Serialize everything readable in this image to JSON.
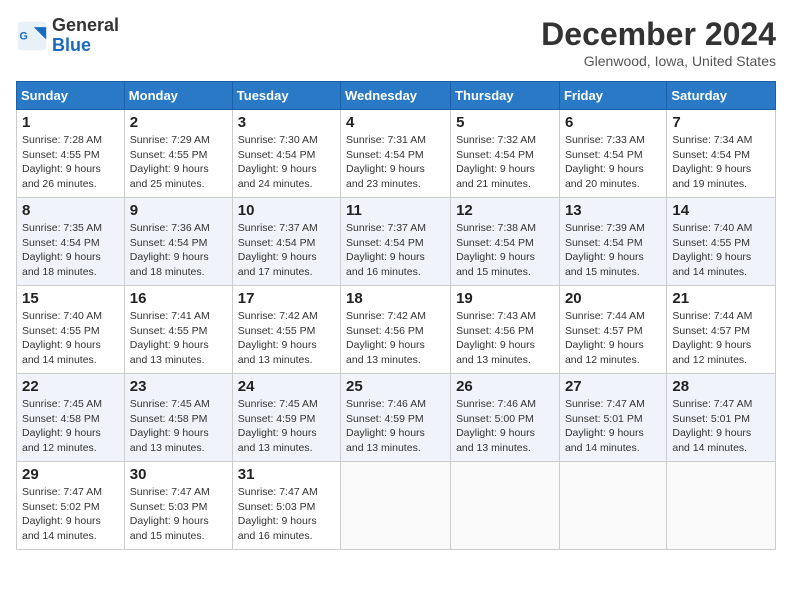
{
  "header": {
    "logo": {
      "general": "General",
      "blue": "Blue"
    },
    "title": "December 2024",
    "location": "Glenwood, Iowa, United States"
  },
  "weekdays": [
    "Sunday",
    "Monday",
    "Tuesday",
    "Wednesday",
    "Thursday",
    "Friday",
    "Saturday"
  ],
  "weeks": [
    [
      {
        "day": 1,
        "sunrise": "Sunrise: 7:28 AM",
        "sunset": "Sunset: 4:55 PM",
        "daylight": "Daylight: 9 hours and 26 minutes."
      },
      {
        "day": 2,
        "sunrise": "Sunrise: 7:29 AM",
        "sunset": "Sunset: 4:55 PM",
        "daylight": "Daylight: 9 hours and 25 minutes."
      },
      {
        "day": 3,
        "sunrise": "Sunrise: 7:30 AM",
        "sunset": "Sunset: 4:54 PM",
        "daylight": "Daylight: 9 hours and 24 minutes."
      },
      {
        "day": 4,
        "sunrise": "Sunrise: 7:31 AM",
        "sunset": "Sunset: 4:54 PM",
        "daylight": "Daylight: 9 hours and 23 minutes."
      },
      {
        "day": 5,
        "sunrise": "Sunrise: 7:32 AM",
        "sunset": "Sunset: 4:54 PM",
        "daylight": "Daylight: 9 hours and 21 minutes."
      },
      {
        "day": 6,
        "sunrise": "Sunrise: 7:33 AM",
        "sunset": "Sunset: 4:54 PM",
        "daylight": "Daylight: 9 hours and 20 minutes."
      },
      {
        "day": 7,
        "sunrise": "Sunrise: 7:34 AM",
        "sunset": "Sunset: 4:54 PM",
        "daylight": "Daylight: 9 hours and 19 minutes."
      }
    ],
    [
      {
        "day": 8,
        "sunrise": "Sunrise: 7:35 AM",
        "sunset": "Sunset: 4:54 PM",
        "daylight": "Daylight: 9 hours and 18 minutes."
      },
      {
        "day": 9,
        "sunrise": "Sunrise: 7:36 AM",
        "sunset": "Sunset: 4:54 PM",
        "daylight": "Daylight: 9 hours and 18 minutes."
      },
      {
        "day": 10,
        "sunrise": "Sunrise: 7:37 AM",
        "sunset": "Sunset: 4:54 PM",
        "daylight": "Daylight: 9 hours and 17 minutes."
      },
      {
        "day": 11,
        "sunrise": "Sunrise: 7:37 AM",
        "sunset": "Sunset: 4:54 PM",
        "daylight": "Daylight: 9 hours and 16 minutes."
      },
      {
        "day": 12,
        "sunrise": "Sunrise: 7:38 AM",
        "sunset": "Sunset: 4:54 PM",
        "daylight": "Daylight: 9 hours and 15 minutes."
      },
      {
        "day": 13,
        "sunrise": "Sunrise: 7:39 AM",
        "sunset": "Sunset: 4:54 PM",
        "daylight": "Daylight: 9 hours and 15 minutes."
      },
      {
        "day": 14,
        "sunrise": "Sunrise: 7:40 AM",
        "sunset": "Sunset: 4:55 PM",
        "daylight": "Daylight: 9 hours and 14 minutes."
      }
    ],
    [
      {
        "day": 15,
        "sunrise": "Sunrise: 7:40 AM",
        "sunset": "Sunset: 4:55 PM",
        "daylight": "Daylight: 9 hours and 14 minutes."
      },
      {
        "day": 16,
        "sunrise": "Sunrise: 7:41 AM",
        "sunset": "Sunset: 4:55 PM",
        "daylight": "Daylight: 9 hours and 13 minutes."
      },
      {
        "day": 17,
        "sunrise": "Sunrise: 7:42 AM",
        "sunset": "Sunset: 4:55 PM",
        "daylight": "Daylight: 9 hours and 13 minutes."
      },
      {
        "day": 18,
        "sunrise": "Sunrise: 7:42 AM",
        "sunset": "Sunset: 4:56 PM",
        "daylight": "Daylight: 9 hours and 13 minutes."
      },
      {
        "day": 19,
        "sunrise": "Sunrise: 7:43 AM",
        "sunset": "Sunset: 4:56 PM",
        "daylight": "Daylight: 9 hours and 13 minutes."
      },
      {
        "day": 20,
        "sunrise": "Sunrise: 7:44 AM",
        "sunset": "Sunset: 4:57 PM",
        "daylight": "Daylight: 9 hours and 12 minutes."
      },
      {
        "day": 21,
        "sunrise": "Sunrise: 7:44 AM",
        "sunset": "Sunset: 4:57 PM",
        "daylight": "Daylight: 9 hours and 12 minutes."
      }
    ],
    [
      {
        "day": 22,
        "sunrise": "Sunrise: 7:45 AM",
        "sunset": "Sunset: 4:58 PM",
        "daylight": "Daylight: 9 hours and 12 minutes."
      },
      {
        "day": 23,
        "sunrise": "Sunrise: 7:45 AM",
        "sunset": "Sunset: 4:58 PM",
        "daylight": "Daylight: 9 hours and 13 minutes."
      },
      {
        "day": 24,
        "sunrise": "Sunrise: 7:45 AM",
        "sunset": "Sunset: 4:59 PM",
        "daylight": "Daylight: 9 hours and 13 minutes."
      },
      {
        "day": 25,
        "sunrise": "Sunrise: 7:46 AM",
        "sunset": "Sunset: 4:59 PM",
        "daylight": "Daylight: 9 hours and 13 minutes."
      },
      {
        "day": 26,
        "sunrise": "Sunrise: 7:46 AM",
        "sunset": "Sunset: 5:00 PM",
        "daylight": "Daylight: 9 hours and 13 minutes."
      },
      {
        "day": 27,
        "sunrise": "Sunrise: 7:47 AM",
        "sunset": "Sunset: 5:01 PM",
        "daylight": "Daylight: 9 hours and 14 minutes."
      },
      {
        "day": 28,
        "sunrise": "Sunrise: 7:47 AM",
        "sunset": "Sunset: 5:01 PM",
        "daylight": "Daylight: 9 hours and 14 minutes."
      }
    ],
    [
      {
        "day": 29,
        "sunrise": "Sunrise: 7:47 AM",
        "sunset": "Sunset: 5:02 PM",
        "daylight": "Daylight: 9 hours and 14 minutes."
      },
      {
        "day": 30,
        "sunrise": "Sunrise: 7:47 AM",
        "sunset": "Sunset: 5:03 PM",
        "daylight": "Daylight: 9 hours and 15 minutes."
      },
      {
        "day": 31,
        "sunrise": "Sunrise: 7:47 AM",
        "sunset": "Sunset: 5:03 PM",
        "daylight": "Daylight: 9 hours and 16 minutes."
      },
      null,
      null,
      null,
      null
    ]
  ]
}
